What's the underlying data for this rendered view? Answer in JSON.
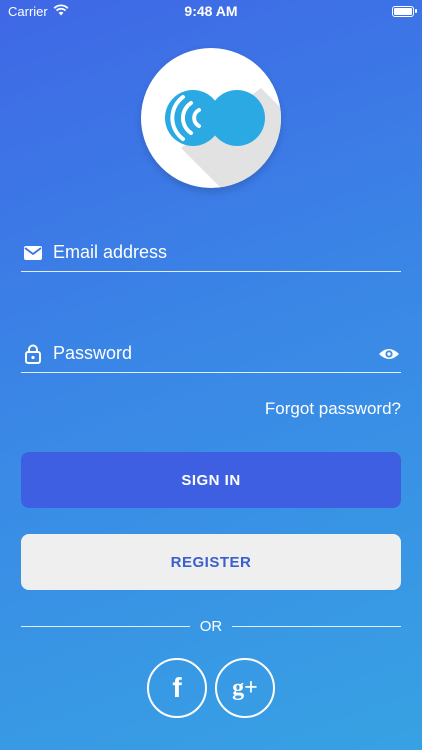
{
  "status_bar": {
    "carrier": "Carrier",
    "time": "9:48 AM",
    "battery_level": 1.0
  },
  "logo": {
    "icon": "logo-wave-icon"
  },
  "login_form": {
    "email_placeholder": "Email address",
    "email_icon": "mail-icon",
    "password_placeholder": "Password",
    "password_icon": "lock-icon",
    "visibility_icon": "eye-icon",
    "forgot_password": "Forgot password?"
  },
  "actions": {
    "sign_in": "SIGN IN",
    "register": "REGISTER"
  },
  "divider": {
    "or": "OR"
  },
  "social": {
    "facebook_label": "f",
    "google_label": "g+"
  },
  "colors": {
    "gradient_start": "#3f67e6",
    "gradient_end": "#37a2e3",
    "sign_in_bg": "#3f5fe2",
    "register_bg": "#efefef",
    "register_text": "#3b5fce"
  }
}
